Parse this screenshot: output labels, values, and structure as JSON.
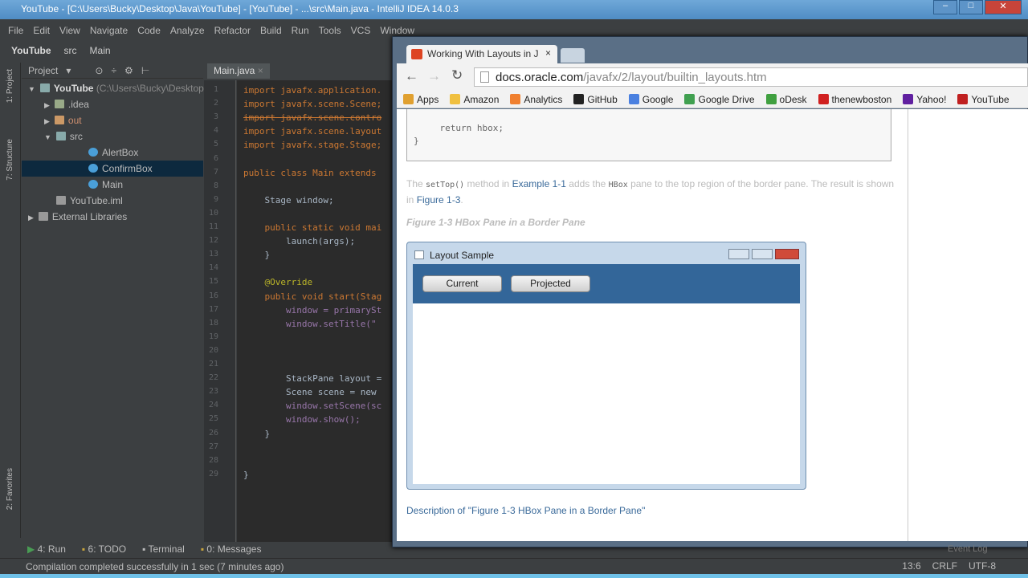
{
  "ide": {
    "title": "YouTube - [C:\\Users\\Bucky\\Desktop\\Java\\YouTube] - [YouTube] - ...\\src\\Main.java - IntelliJ IDEA 14.0.3",
    "menu": [
      "File",
      "Edit",
      "View",
      "Navigate",
      "Code",
      "Analyze",
      "Refactor",
      "Build",
      "Run",
      "Tools",
      "VCS",
      "Window"
    ],
    "nav": [
      "YouTube",
      "src",
      "Main"
    ],
    "side_tabs": [
      "1: Project",
      "7: Structure",
      "2: Favorites"
    ],
    "project_header": "Project",
    "tree": [
      {
        "label": "YouTube",
        "extra": "(C:\\Users\\Bucky\\Desktop",
        "depth": 0
      },
      {
        "label": ".idea",
        "depth": 1
      },
      {
        "label": "out",
        "depth": 1
      },
      {
        "label": "src",
        "depth": 1
      },
      {
        "label": "AlertBox",
        "depth": 2
      },
      {
        "label": "ConfirmBox",
        "depth": 2
      },
      {
        "label": "Main",
        "depth": 2
      },
      {
        "label": "YouTube.iml",
        "depth": 1
      },
      {
        "label": "External Libraries",
        "depth": 0
      }
    ],
    "editor_tab": "Main.java",
    "code": [
      "import javafx.application.",
      "import javafx.scene.Scene;",
      "import javafx.scene.contro",
      "import javafx.scene.layout",
      "import javafx.stage.Stage;",
      "",
      "public class Main extends",
      "",
      "    Stage window;",
      "",
      "    public static void mai",
      "        launch(args);",
      "    }",
      "",
      "    @Override",
      "    public void start(Stag",
      "        window = primarySt",
      "        window.setTitle(\"",
      "",
      "",
      "",
      "        StackPane layout =",
      "        Scene scene = new ",
      "        window.setScene(sc",
      "        window.show();",
      "    }",
      "",
      "",
      "}"
    ],
    "bottom_tools": [
      "4: Run",
      "6: TODO",
      "Terminal",
      "0: Messages"
    ],
    "status": "Compilation completed successfully in 1 sec (7 minutes ago)",
    "status_right": [
      "13:6",
      "CRLF",
      "UTF-8"
    ],
    "event_log": "Event Log"
  },
  "browser": {
    "tab_title": "Working With Layouts in J",
    "url_host": "docs.oracle.com",
    "url_path": "/javafx/2/layout/builtin_layouts.htm",
    "bookmarks": [
      {
        "label": "Apps",
        "color": "#e0a030"
      },
      {
        "label": "Amazon",
        "color": "#f0c040"
      },
      {
        "label": "Analytics",
        "color": "#f08030"
      },
      {
        "label": "GitHub",
        "color": "#222222"
      },
      {
        "label": "Google",
        "color": "#4a80e0"
      },
      {
        "label": "Google Drive",
        "color": "#40a050"
      },
      {
        "label": "oDesk",
        "color": "#40a040"
      },
      {
        "label": "thenewboston",
        "color": "#d02020"
      },
      {
        "label": "Yahoo!",
        "color": "#6020a0"
      },
      {
        "label": "YouTube",
        "color": "#c02020"
      }
    ],
    "code_lines": [
      "    return hbox;",
      "}"
    ],
    "para": {
      "t1": "The ",
      "c1": "setTop()",
      "t2": " method in ",
      "l1": "Example 1-1",
      "t3": " adds the ",
      "c2": "HBox",
      "t4": " pane to the top region of the border pane. The result is shown in ",
      "l2": "Figure 1-3",
      "t5": "."
    },
    "figure_caption": "Figure 1-3 HBox Pane in a Border Pane",
    "figure": {
      "window_title": "Layout Sample",
      "buttons": [
        "Current",
        "Projected"
      ]
    },
    "description_link": "Description of \"Figure 1-3 HBox Pane in a Border Pane\""
  }
}
